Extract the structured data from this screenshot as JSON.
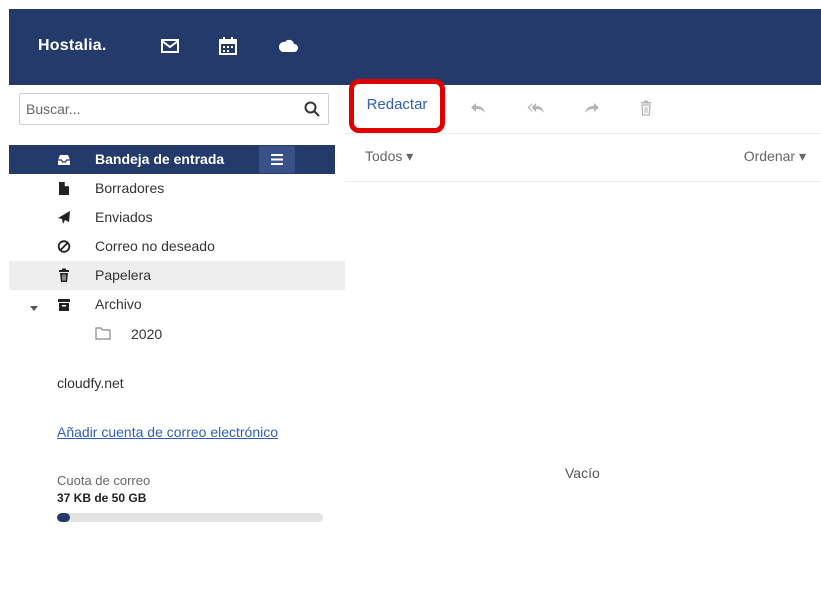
{
  "app": {
    "brand": "Hostalia."
  },
  "nav_icons": [
    "mail-icon",
    "calendar-icon",
    "cloud-icon"
  ],
  "search": {
    "placeholder": "Buscar..."
  },
  "folders": [
    {
      "label": "Bandeja de entrada",
      "icon": "inbox-icon",
      "active": true
    },
    {
      "label": "Borradores",
      "icon": "file-icon"
    },
    {
      "label": "Enviados",
      "icon": "send-icon"
    },
    {
      "label": "Correo no deseado",
      "icon": "ban-icon"
    },
    {
      "label": "Papelera",
      "icon": "trash-icon"
    },
    {
      "label": "Archivo",
      "icon": "archive-icon",
      "expanded": true
    }
  ],
  "subfolders": [
    {
      "label": "2020",
      "icon": "folder-outline-icon"
    }
  ],
  "account": {
    "name": "cloudfy.net",
    "add_link": "Añadir cuenta de correo electrónico"
  },
  "quota": {
    "label": "Cuota de correo",
    "value": "37 KB de 50 GB",
    "used_fraction": 0.05
  },
  "toolbar": {
    "compose": "Redactar",
    "tools": [
      "reply-icon",
      "reply-all-icon",
      "forward-icon",
      "delete-icon"
    ]
  },
  "list": {
    "filter": "Todos ▾",
    "sort": "Ordenar ▾",
    "empty": "Vacío"
  },
  "colors": {
    "header": "#233a6b",
    "link": "#2f5fb3",
    "highlight": "#e00000"
  }
}
